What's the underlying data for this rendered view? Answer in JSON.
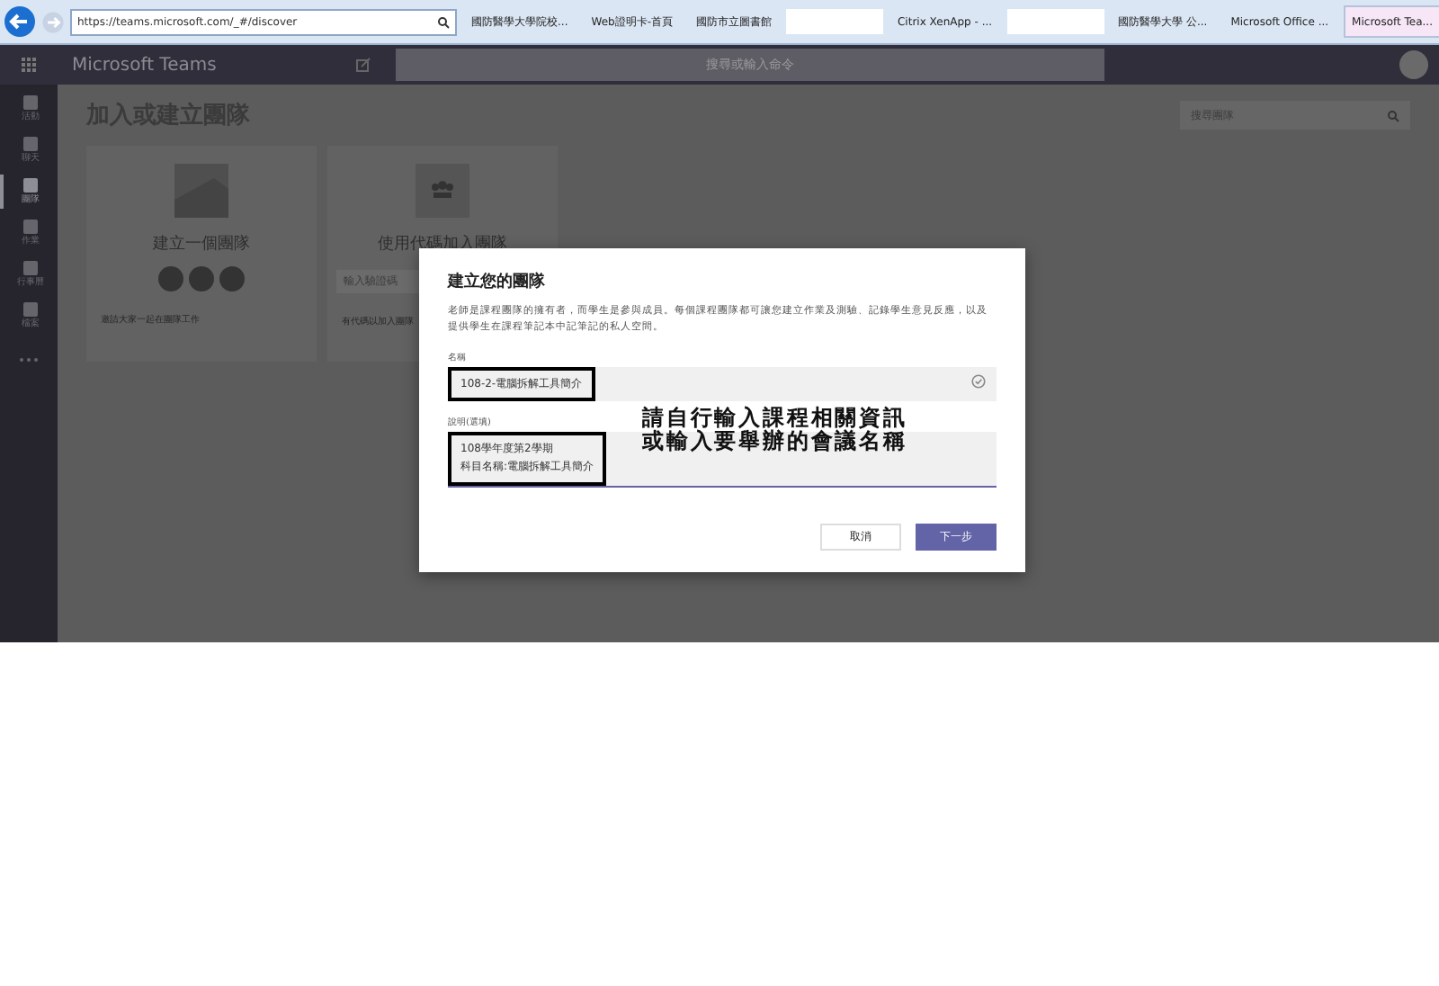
{
  "browser": {
    "url": "https://teams.microsoft.com/_#/discover",
    "tabs": [
      {
        "kind": "tab",
        "title": "國防醫學大學院校...",
        "selected": false
      },
      {
        "kind": "tab",
        "title": "Web證明卡-首頁",
        "selected": false
      },
      {
        "kind": "tab",
        "title": "國防市立圖書館",
        "selected": false
      },
      {
        "kind": "redacted",
        "selected": false
      },
      {
        "kind": "tab",
        "title": "Citrix XenApp - ...",
        "selected": false
      },
      {
        "kind": "redacted",
        "selected": false
      },
      {
        "kind": "tab",
        "title": "國防醫學大學 公...",
        "selected": false
      },
      {
        "kind": "tab",
        "title": "Microsoft Office ...",
        "selected": false
      },
      {
        "kind": "tab",
        "title": "Microsoft Tea...",
        "selected": true
      }
    ]
  },
  "header": {
    "app_name": "Microsoft Teams",
    "search": {
      "placeholder": "搜尋或輸入命令"
    }
  },
  "sidebar": {
    "items": [
      {
        "label": "活動",
        "selected": false
      },
      {
        "label": "聊天",
        "selected": false
      },
      {
        "label": "團隊",
        "selected": true
      },
      {
        "label": "作業",
        "selected": false
      },
      {
        "label": "行事曆",
        "selected": false
      },
      {
        "label": "檔案",
        "selected": false
      }
    ]
  },
  "page": {
    "title": "加入或建立團隊",
    "search": {
      "placeholder": "搜尋團隊"
    },
    "cards": [
      {
        "kind": "create",
        "title": "建立一個團隊",
        "caption": "邀請大家一起在團隊工作"
      },
      {
        "kind": "join",
        "title": "使用代碼加入團隊",
        "placeholder": "輸入驗證碼",
        "caption": "有代碼以加入團隊"
      }
    ]
  },
  "dialog": {
    "title": "建立您的團隊",
    "description": "老師是課程團隊的擁有者，而學生是參與成員。每個課程團隊都可讓您建立作業及測驗、記錄學生意見反應，以及提供學生在課程筆記本中記筆記的私人空間。",
    "fields": [
      {
        "kind": "input",
        "label": "名稱",
        "value": "108-2-電腦拆解工具簡介",
        "valid": true,
        "highlighted": true
      },
      {
        "kind": "textarea",
        "label": "說明(選填)",
        "lines": [
          "108學年度第2學期",
          "科目名稱:電腦拆解工具簡介"
        ],
        "valid": false,
        "highlighted": true
      }
    ],
    "annotation": [
      "請自行輸入課程相關資訊",
      "或輸入要舉辦的會議名稱"
    ],
    "buttons": [
      {
        "kind": "secondary",
        "label": "取消"
      },
      {
        "kind": "primary",
        "label": "下一步"
      }
    ]
  }
}
